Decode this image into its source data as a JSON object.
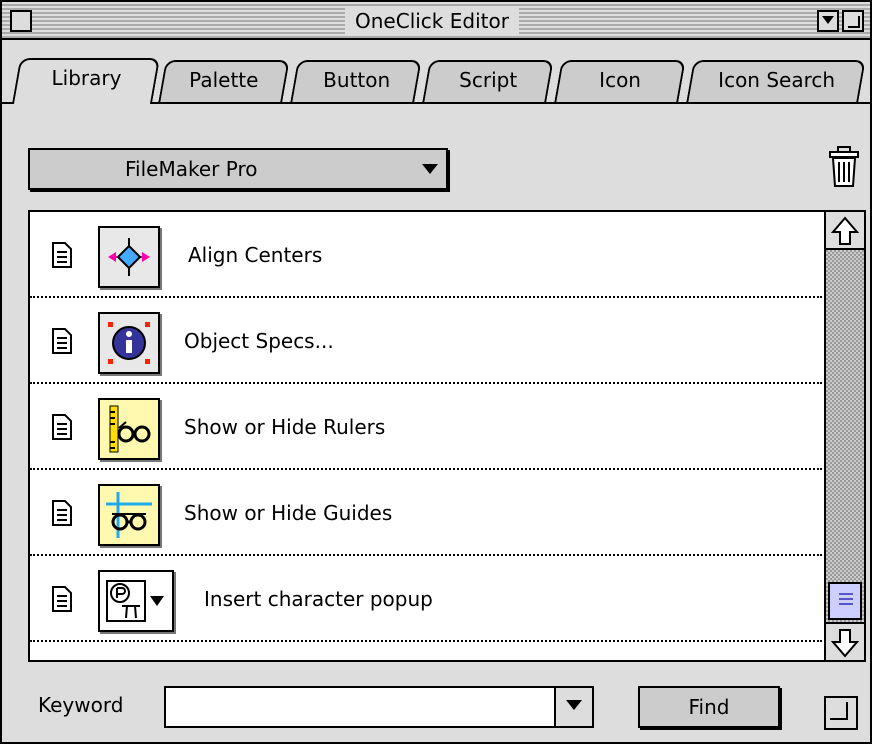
{
  "window": {
    "title": "OneClick Editor"
  },
  "tabs": [
    {
      "label": "Library",
      "active": true
    },
    {
      "label": "Palette",
      "active": false
    },
    {
      "label": "Button",
      "active": false
    },
    {
      "label": "Script",
      "active": false
    },
    {
      "label": "Icon",
      "active": false
    },
    {
      "label": "Icon Search",
      "active": false
    }
  ],
  "library": {
    "selected": "FileMaker Pro"
  },
  "buttons": [
    {
      "label": "Align Centers",
      "icon": "align-centers-icon"
    },
    {
      "label": "Object Specs...",
      "icon": "info-icon"
    },
    {
      "label": "Show or Hide Rulers",
      "icon": "rulers-glasses-icon"
    },
    {
      "label": "Show or Hide Guides",
      "icon": "guides-glasses-icon"
    },
    {
      "label": "Insert character popup",
      "icon": "character-popup-icon"
    }
  ],
  "search": {
    "label": "Keyword",
    "value": "",
    "find_label": "Find"
  },
  "colors": {
    "window_bg": "#dddddd",
    "list_bg": "#ffffff",
    "thumb": "#cdd0ff"
  }
}
